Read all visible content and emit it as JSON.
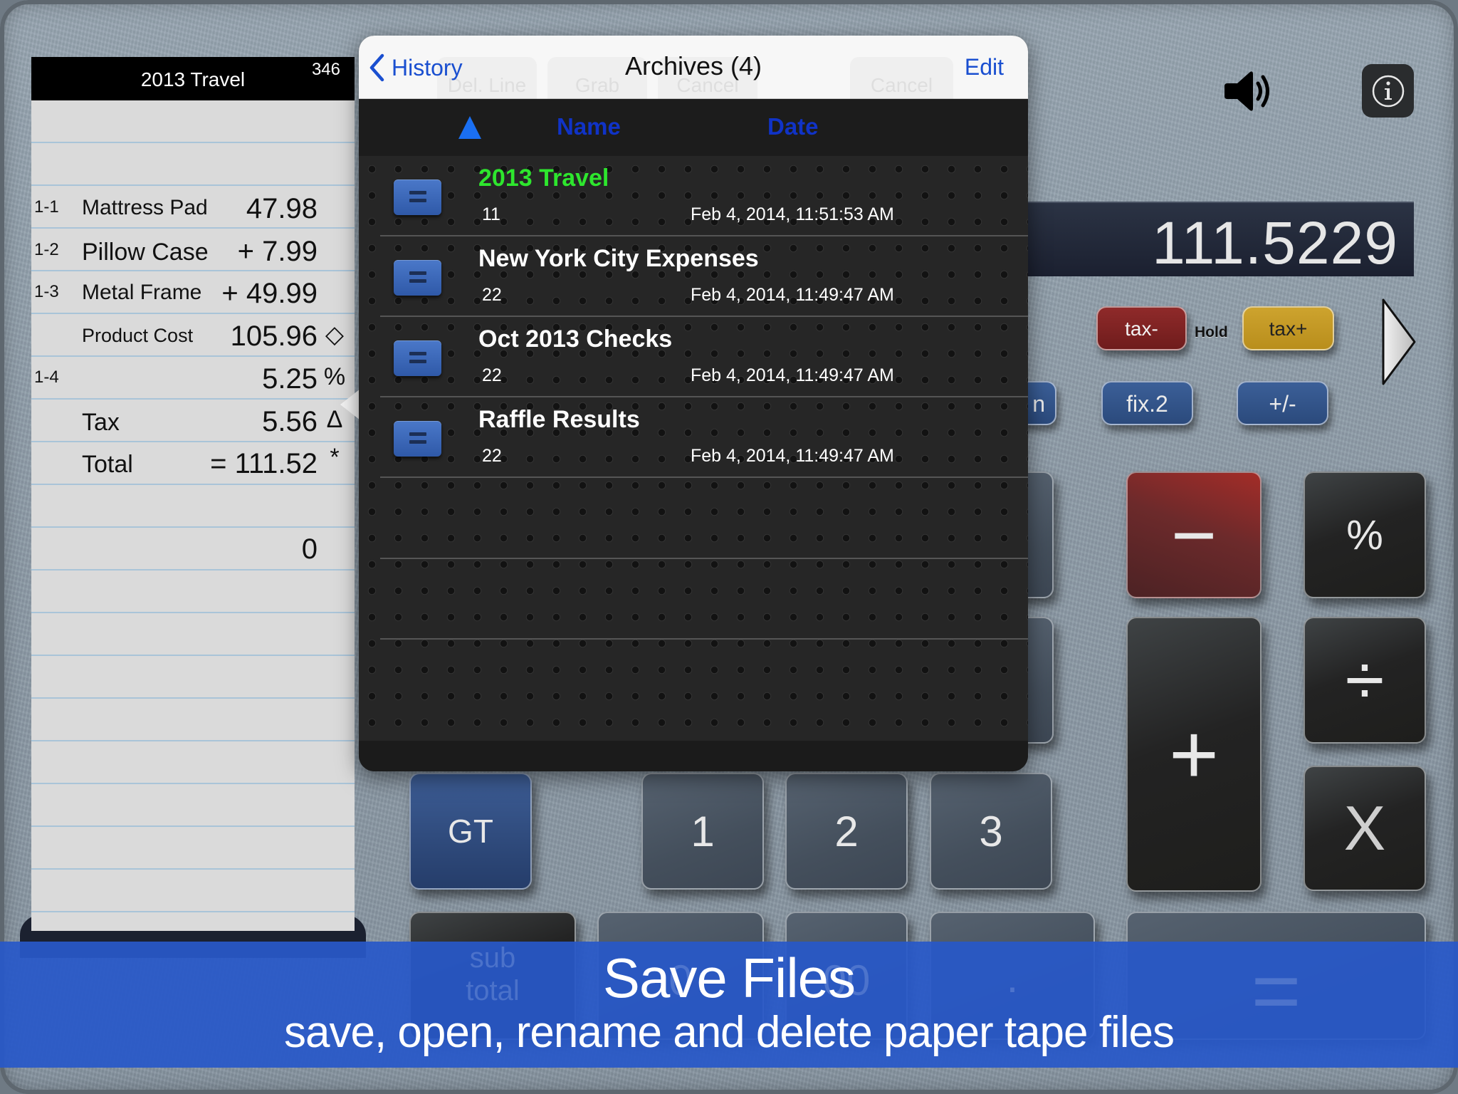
{
  "tape": {
    "title": "2013 Travel",
    "count": "346",
    "rows": [
      {
        "index": "1-1",
        "label": "Mattress Pad",
        "value": "47.98",
        "mark": ""
      },
      {
        "index": "1-2",
        "label": "Pillow Case",
        "value": "+ 7.99",
        "mark": ""
      },
      {
        "index": "1-3",
        "label": "Metal Frame",
        "value": "+ 49.99",
        "mark": ""
      },
      {
        "index": "",
        "label": "Product Cost",
        "value": "105.96",
        "mark": "◇"
      },
      {
        "index": "1-4",
        "label": "",
        "value": "5.25",
        "mark": "%"
      },
      {
        "index": "",
        "label": "Tax",
        "value": "5.56",
        "mark": "Δ"
      },
      {
        "index": "",
        "label": "Total",
        "value": "= 111.52",
        "mark": "*"
      },
      {
        "index": "",
        "label": "",
        "value": "",
        "mark": ""
      },
      {
        "index": "",
        "label": "",
        "value": "0",
        "mark": ""
      }
    ]
  },
  "popover": {
    "back_label": "History",
    "title": "Archives (4)",
    "edit_label": "Edit",
    "ghost_buttons": [
      "Del. Line",
      "Grab",
      "Cancel",
      "Cancel"
    ],
    "columns": {
      "sort_icon": "triangle-up-icon",
      "name": "Name",
      "date": "Date"
    },
    "items": [
      {
        "name": "2013 Travel",
        "count": "11",
        "date": "Feb 4, 2014, 11:51:53 AM",
        "active": true
      },
      {
        "name": "New York City Expenses",
        "count": "22",
        "date": "Feb 4, 2014, 11:49:47 AM",
        "active": false
      },
      {
        "name": "Oct 2013 Checks",
        "count": "22",
        "date": "Feb 4, 2014, 11:49:47 AM",
        "active": false
      },
      {
        "name": "Raffle Results",
        "count": "22",
        "date": "Feb 4, 2014, 11:49:47 AM",
        "active": false
      }
    ]
  },
  "calculator": {
    "display": "111.5229",
    "speaker_icon": "speaker-icon",
    "info_icon": "info-icon",
    "tax_minus": "tax-",
    "hold": "Hold",
    "tax_plus": "tax+",
    "partial_key": "n",
    "fix": "fix.2",
    "plus_minus": "+/-",
    "keys": {
      "minus": "−",
      "percent": "%",
      "plus": "+",
      "divide": "÷",
      "multiply": "X",
      "gt": "GT",
      "one": "1",
      "two": "2",
      "three": "3",
      "subtotal_line1": "sub",
      "subtotal_line2": "total",
      "zero": "0",
      "double_zero": "00",
      "decimal": ".",
      "equals": "="
    }
  },
  "banner": {
    "title": "Save Files",
    "subtitle": "save, open, rename and delete paper tape files"
  },
  "colors": {
    "accent_blue": "#1a4fd0",
    "active_file": "#2ee62e",
    "banner": "#2858c8"
  }
}
